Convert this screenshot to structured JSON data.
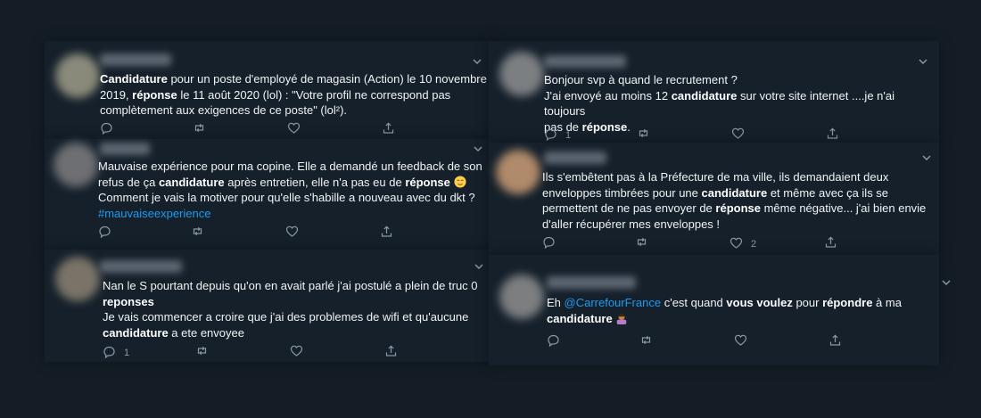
{
  "tweets": [
    {
      "id": "t1",
      "lines": [
        [
          {
            "t": "Candidature",
            "b": true
          },
          {
            "t": " pour un poste d'employé de magasin (Action) le 10 novembre"
          }
        ],
        [
          {
            "t": "2019, "
          },
          {
            "t": "réponse",
            "b": true
          },
          {
            "t": " le 11 août 2020 (lol) : \"Votre profil ne correspond pas"
          }
        ],
        [
          {
            "t": "complètement aux exigences de ce poste\" (lol²)."
          }
        ]
      ],
      "reply_count": "",
      "retweet_count": "",
      "like_count": ""
    },
    {
      "id": "t2",
      "lines": [
        [
          {
            "t": "Mauvaise expérience pour ma copine. Elle a demandé un feedback de son"
          }
        ],
        [
          {
            "t": "refus de ça "
          },
          {
            "t": "candidature",
            "b": true
          },
          {
            "t": " après entretien, elle n'a pas eu de "
          },
          {
            "t": "réponse",
            "b": true
          },
          {
            "t": " "
          },
          {
            "emoji": "relieved"
          }
        ],
        [
          {
            "t": "Comment je vais la motiver pour qu'elle s'habille a nouveau avec du dkt ?"
          }
        ],
        [
          {
            "t": "#mauvaiseexperience",
            "c": "hashtag"
          }
        ]
      ],
      "reply_count": "",
      "retweet_count": "",
      "like_count": ""
    },
    {
      "id": "t3",
      "lines": [
        [
          {
            "t": "Nan le S pourtant depuis qu'on en avait parlé j'ai postulé a plein de truc 0"
          }
        ],
        [
          {
            "t": "reponses",
            "b": true
          }
        ],
        [
          {
            "t": "Je vais commencer a croire que j'ai des problemes de wifi et qu'aucune"
          }
        ],
        [
          {
            "t": "candidature",
            "b": true
          },
          {
            "t": " a ete envoyee"
          }
        ]
      ],
      "reply_count": "1",
      "retweet_count": "",
      "like_count": ""
    },
    {
      "id": "t4",
      "lines": [
        [
          {
            "t": "Bonjour svp à quand le recrutement ?"
          }
        ],
        [
          {
            "t": "J'ai envoyé au moins 12 "
          },
          {
            "t": "candidature",
            "b": true
          },
          {
            "t": " sur votre site internet  ....je n'ai toujours"
          }
        ],
        [
          {
            "t": "pas de "
          },
          {
            "t": "réponse",
            "b": true
          },
          {
            "t": "."
          }
        ]
      ],
      "reply_count": "1",
      "retweet_count": "",
      "like_count": ""
    },
    {
      "id": "t5",
      "lines": [
        [
          {
            "t": "Ils s'embêtent pas à la Préfecture de ma ville, ils demandaient deux"
          }
        ],
        [
          {
            "t": "enveloppes timbrées pour une "
          },
          {
            "t": "candidature",
            "b": true
          },
          {
            "t": " et même avec ça ils se"
          }
        ],
        [
          {
            "t": "permettent de ne pas envoyer de "
          },
          {
            "t": "réponse",
            "b": true
          },
          {
            "t": " même négative... j'ai bien envie"
          }
        ],
        [
          {
            "t": "d'aller récupérer mes enveloppes !"
          }
        ]
      ],
      "reply_count": "",
      "retweet_count": "",
      "like_count": "2"
    },
    {
      "id": "t6",
      "lines": [
        [
          {
            "t": "Eh "
          },
          {
            "t": "@CarrefourFrance",
            "c": "mention"
          },
          {
            "t": "  c'est quand "
          },
          {
            "t": "vous voulez",
            "b": true
          },
          {
            "t": " pour "
          },
          {
            "t": "répondre",
            "b": true
          },
          {
            "t": " à ma"
          }
        ],
        [
          {
            "t": "candidature",
            "b": true
          },
          {
            "t": " "
          },
          {
            "emoji": "shrug"
          }
        ]
      ],
      "reply_count": "",
      "retweet_count": "",
      "like_count": ""
    }
  ],
  "icons": {
    "reply": "reply-icon",
    "retweet": "retweet-icon",
    "like": "like-icon",
    "share": "share-icon",
    "more": "chevron-down-icon"
  },
  "colors": {
    "background": "#141d26",
    "card": "#15202b",
    "link": "#1d9bf0",
    "icon": "#8b98a5"
  }
}
